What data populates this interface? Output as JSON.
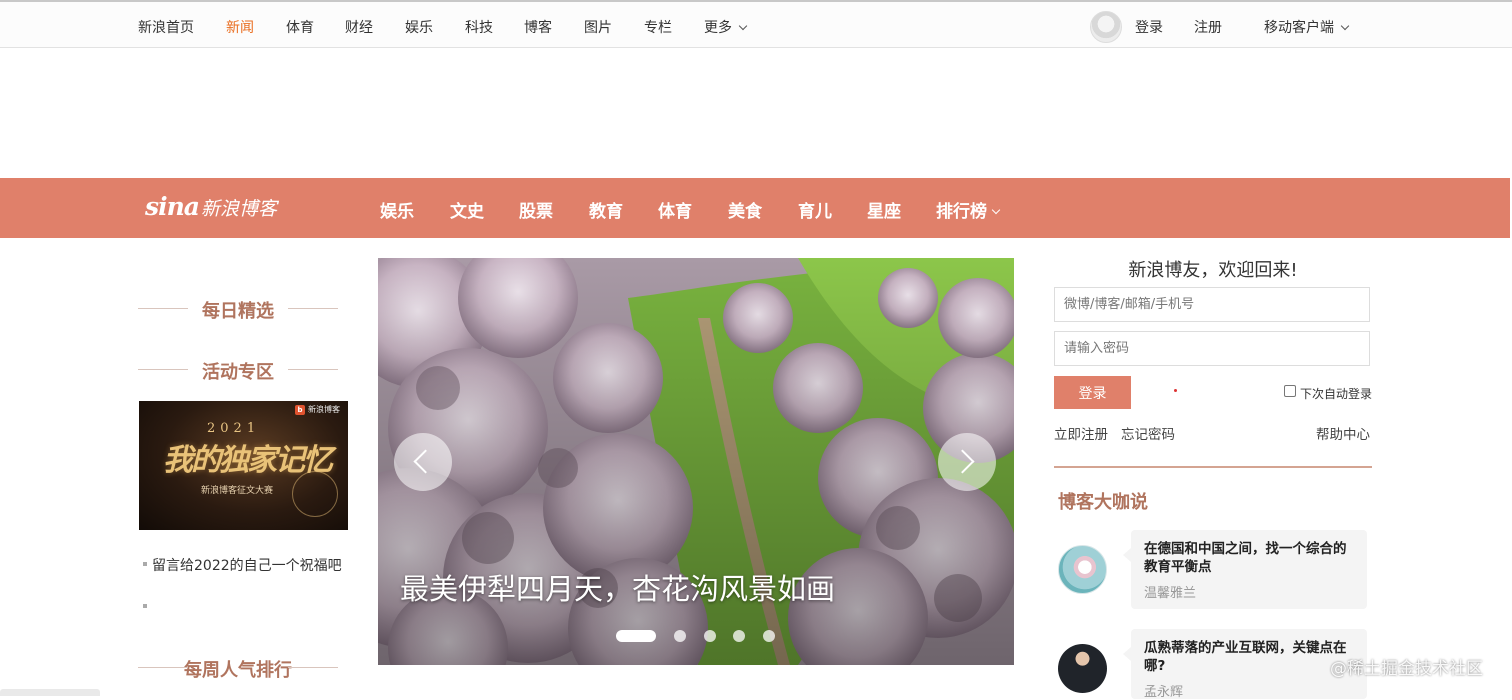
{
  "top_nav": {
    "items": [
      "新浪首页",
      "新闻",
      "体育",
      "财经",
      "娱乐",
      "科技",
      "博客",
      "图片",
      "专栏",
      "更多"
    ],
    "active": "新闻",
    "login": "登录",
    "register": "注册",
    "mobile": "移动客户端"
  },
  "blog_header": {
    "logo_sina": "sina",
    "logo_text": "新浪博客",
    "nav": [
      "娱乐",
      "文史",
      "股票",
      "教育",
      "体育",
      "美食",
      "育儿",
      "星座",
      "排行榜"
    ]
  },
  "left_col": {
    "daily_picks": "每日精选",
    "events": "活动专区",
    "promo": {
      "badge": "新浪博客",
      "year": "2021",
      "title": "我的独家记忆",
      "subtitle": "新浪博客征文大赛"
    },
    "list_item": "留言给2022的自己一个祝福吧",
    "weekly_rank": "每周人气排行"
  },
  "carousel": {
    "caption": "最美伊犁四月天，杏花沟风景如画",
    "slide_count": 5,
    "active_index": 0
  },
  "login_box": {
    "welcome": "新浪博友，欢迎回来!",
    "username_placeholder": "微博/博客/邮箱/手机号",
    "password_placeholder": "请输入密码",
    "login_button": "登录",
    "remember_label": "下次自动登录",
    "register_link": "立即注册",
    "forgot_link": "忘记密码",
    "help_link": "帮助中心"
  },
  "bloggers": {
    "title": "博客大咖说",
    "items": [
      {
        "title": "在德国和中国之间，找一个综合的教育平衡点",
        "author": "温馨雅兰"
      },
      {
        "title": "瓜熟蒂落的产业互联网，关键点在哪?",
        "author": "孟永辉"
      }
    ]
  },
  "watermark": "@稀土掘金技术社区",
  "colors": {
    "accent": "#e0806a",
    "active_nav": "#e96d1f",
    "section_title": "#b0745e"
  }
}
